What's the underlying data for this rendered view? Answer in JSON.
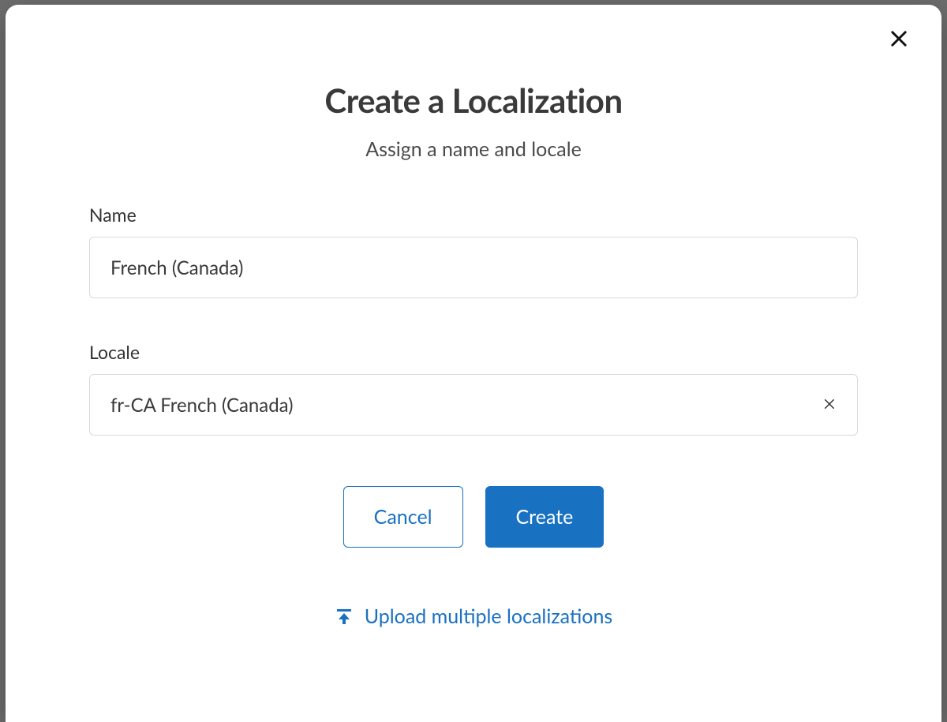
{
  "modal": {
    "title": "Create a Localization",
    "subtitle": "Assign a name and locale",
    "fields": {
      "name": {
        "label": "Name",
        "value": "French (Canada)"
      },
      "locale": {
        "label": "Locale",
        "value": "fr-CA French (Canada)"
      }
    },
    "buttons": {
      "cancel": "Cancel",
      "create": "Create"
    },
    "upload_link": "Upload multiple localizations"
  }
}
